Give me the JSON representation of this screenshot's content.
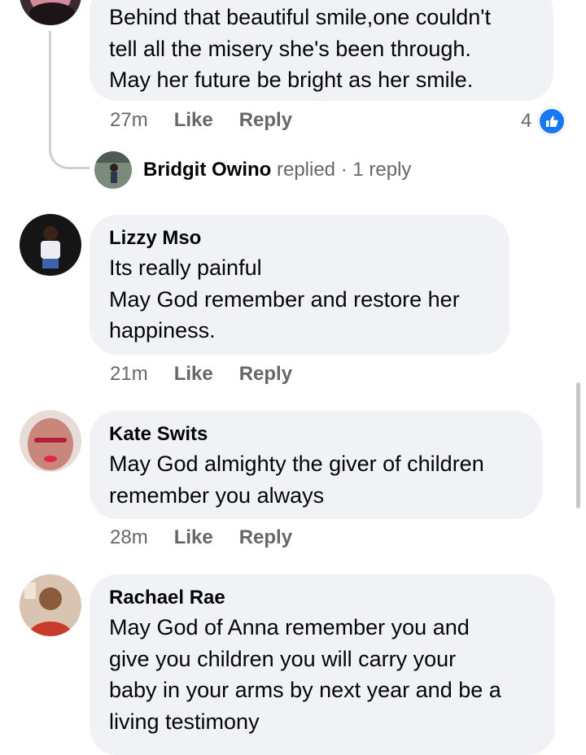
{
  "comments": [
    {
      "text": "Behind that beautiful smile,one couldn't\ntell all the misery she's been through.\nMay her future be bright as her smile.",
      "time": "27m",
      "like_label": "Like",
      "reply_label": "Reply",
      "reaction_count": "4"
    },
    {
      "author": "Lizzy Mso",
      "text": "Its really painful\nMay God remember and restore her\nhappiness.",
      "time": "21m",
      "like_label": "Like",
      "reply_label": "Reply"
    },
    {
      "author": "Kate Swits",
      "text": "May God almighty the giver of children\nremember you always",
      "time": "28m",
      "like_label": "Like",
      "reply_label": "Reply"
    },
    {
      "author": "Rachael Rae",
      "text": "May God of Anna remember you and\ngive you children you will carry your\nbaby in your arms by next year and be a\nliving testimony"
    }
  ],
  "reply_summary": {
    "name": "Bridgit Owino",
    "verb": "replied",
    "separator": "·",
    "count": "1 reply"
  },
  "colors": {
    "bubble": "#f0f2f5",
    "meta_text": "#65676b",
    "like_blue": "#1877f2"
  }
}
